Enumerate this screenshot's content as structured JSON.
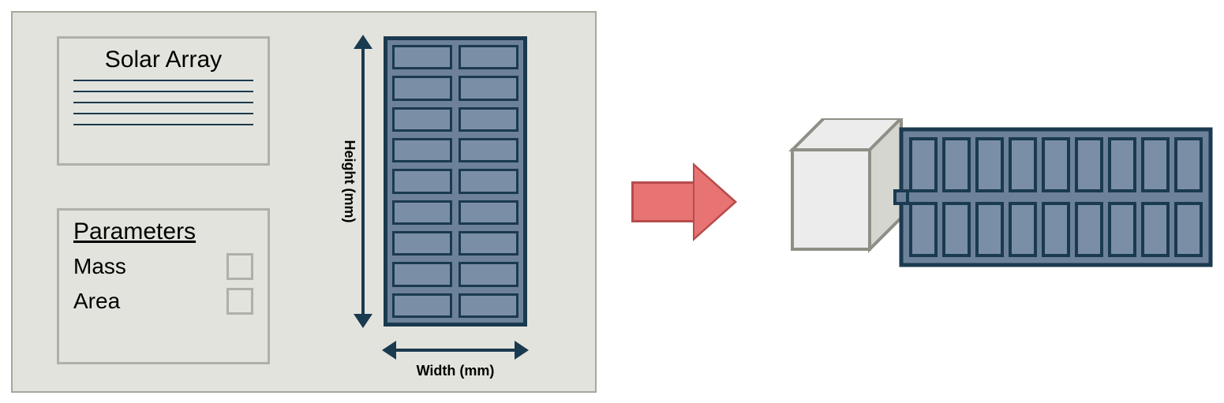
{
  "panel": {
    "solarArray": {
      "title": "Solar Array"
    },
    "parameters": {
      "title": "Parameters",
      "row1": "Mass",
      "row2": "Area"
    },
    "dimensions": {
      "heightLabel": "Height (mm)",
      "widthLabel": "Width (mm)"
    }
  },
  "geometry": {
    "panelFront": {
      "rows": 9,
      "cols": 2
    },
    "deployedPanel": {
      "rows": 2,
      "cols": 9
    }
  },
  "colors": {
    "panelBg": "#e3e3dd",
    "panelBorder": "#a7a79d",
    "ink": "#1a3a4f",
    "panelFill": "#6d829a",
    "panelCell": "#7a8fa6",
    "arrowFill": "#e87373",
    "arrowBorder": "#b74b4b",
    "cubeFace": "#ececec",
    "cubeFaceDark": "#d6d6d0",
    "cubeEdge": "#8f8f87"
  }
}
